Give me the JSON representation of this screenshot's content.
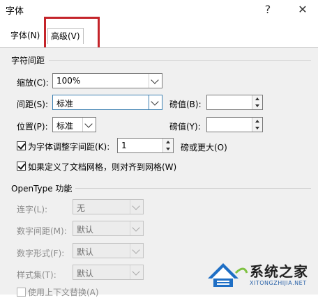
{
  "dialog": {
    "title": "字体",
    "help": "?",
    "close": "✕"
  },
  "tabs": [
    {
      "label": "字体(N)"
    },
    {
      "label": "高级(V)"
    }
  ],
  "char_spacing": {
    "heading": "字符间距",
    "scale": {
      "label": "缩放(C):",
      "value": "100%"
    },
    "spacing": {
      "label": "间距(S):",
      "value": "标准",
      "pt_label": "磅值(B):",
      "pt_value": ""
    },
    "position": {
      "label": "位置(P):",
      "value": "标准",
      "pt_label": "磅值(Y):",
      "pt_value": ""
    },
    "kerning": {
      "label": "为字体调整字间距(K):",
      "value": "1",
      "suffix": "磅或更大(O)",
      "checked": true
    },
    "snap_grid": {
      "label": "如果定义了文档网格，则对齐到网格(W)",
      "checked": true
    }
  },
  "opentype": {
    "heading": "OpenType 功能",
    "ligatures": {
      "label": "连字(L):",
      "value": "无"
    },
    "number_spacing": {
      "label": "数字间距(M):",
      "value": "默认"
    },
    "number_forms": {
      "label": "数字形式(F):",
      "value": "默认"
    },
    "stylistic_sets": {
      "label": "样式集(T):",
      "value": "默认"
    },
    "contextual_alternates": {
      "label": "使用上下文替换(A)",
      "checked": false
    }
  },
  "watermark": {
    "brand": "系统之家",
    "url": "XITONGZHIJIA.NET"
  },
  "colors": {
    "highlight": "#c4242a",
    "panel": "#f0f0f0",
    "logo_blue": "#1f6fc5"
  }
}
